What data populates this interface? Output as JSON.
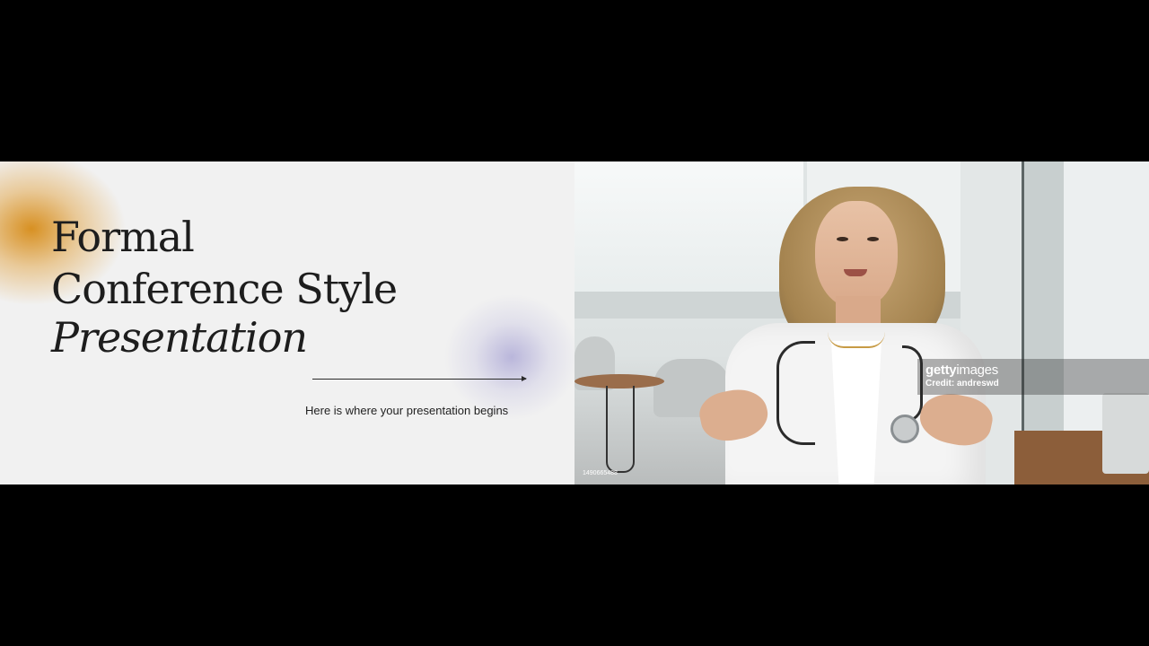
{
  "slide": {
    "title_line1": "Formal",
    "title_line2": "Conference Style",
    "title_line3": "Presentation",
    "subtitle": "Here is where your presentation begins"
  },
  "video": {
    "watermark_brand_bold": "getty",
    "watermark_brand_light": "images",
    "watermark_credit": "Credit: andreswd",
    "image_id": "1490665488"
  },
  "colors": {
    "background": "#000000",
    "slide_bg": "#f1f1f1",
    "accent_orange": "#d68b17",
    "accent_lavender": "#b0acd7",
    "text": "#1d1d1d"
  }
}
